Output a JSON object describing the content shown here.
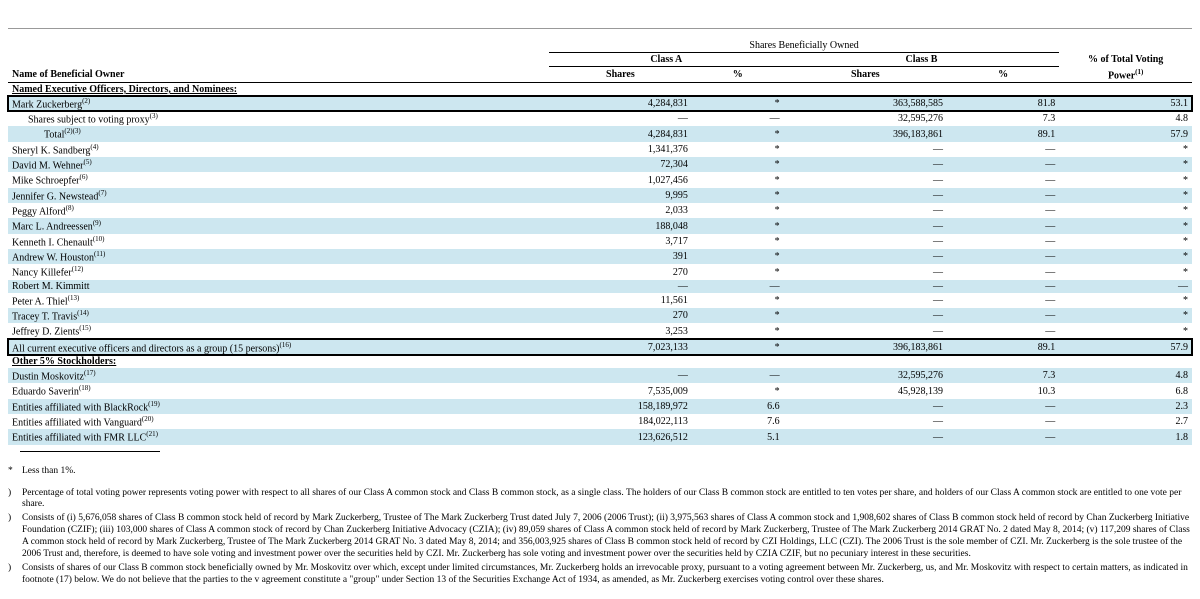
{
  "headers": {
    "main": "Shares Beneficially Owned",
    "name": "Name of Beneficial Owner",
    "classA": "Class A",
    "classB": "Class B",
    "shares": "Shares",
    "pct": "%",
    "voting": "% of Total Voting",
    "power": "Power",
    "power_sup": "(1)"
  },
  "sections": {
    "named": "Named Executive Officers, Directors, and Nominees:",
    "other": "Other 5% Stockholders:"
  },
  "rows": [
    {
      "k": "zuck",
      "alt": true,
      "hl": true,
      "name": "Mark Zuckerberg",
      "sup": "(2)",
      "a_sh": "4,284,831",
      "a_pc": "*",
      "b_sh": "363,588,585",
      "b_pc": "81.8",
      "vp": "53.1"
    },
    {
      "k": "proxy",
      "name": "Shares subject to voting proxy",
      "sup": "(3)",
      "a_sh": "—",
      "a_pc": "—",
      "b_sh": "32,595,276",
      "b_pc": "7.3",
      "vp": "4.8",
      "indent": 1
    },
    {
      "k": "total",
      "alt": true,
      "name": "Total",
      "sup": "(2)(3)",
      "a_sh": "4,284,831",
      "a_pc": "*",
      "b_sh": "396,183,861",
      "b_pc": "89.1",
      "vp": "57.9",
      "indent": 2
    },
    {
      "k": "sandberg",
      "name": "Sheryl K. Sandberg",
      "sup": "(4)",
      "a_sh": "1,341,376",
      "a_pc": "*",
      "b_sh": "—",
      "b_pc": "—",
      "vp": "*"
    },
    {
      "k": "wehner",
      "alt": true,
      "name": "David M. Wehner",
      "sup": "(5)",
      "a_sh": "72,304",
      "a_pc": "*",
      "b_sh": "—",
      "b_pc": "—",
      "vp": "*"
    },
    {
      "k": "schroepfer",
      "name": "Mike Schroepfer",
      "sup": "(6)",
      "a_sh": "1,027,456",
      "a_pc": "*",
      "b_sh": "—",
      "b_pc": "—",
      "vp": "*"
    },
    {
      "k": "newstead",
      "alt": true,
      "name": "Jennifer G. Newstead",
      "sup": "(7)",
      "a_sh": "9,995",
      "a_pc": "*",
      "b_sh": "—",
      "b_pc": "—",
      "vp": "*"
    },
    {
      "k": "alford",
      "name": "Peggy Alford",
      "sup": "(8)",
      "a_sh": "2,033",
      "a_pc": "*",
      "b_sh": "—",
      "b_pc": "—",
      "vp": "*"
    },
    {
      "k": "andreessen",
      "alt": true,
      "name": "Marc L. Andreessen",
      "sup": "(9)",
      "a_sh": "188,048",
      "a_pc": "*",
      "b_sh": "—",
      "b_pc": "—",
      "vp": "*"
    },
    {
      "k": "chenault",
      "name": "Kenneth I. Chenault",
      "sup": "(10)",
      "a_sh": "3,717",
      "a_pc": "*",
      "b_sh": "—",
      "b_pc": "—",
      "vp": "*"
    },
    {
      "k": "houston",
      "alt": true,
      "name": "Andrew W. Houston",
      "sup": "(11)",
      "a_sh": "391",
      "a_pc": "*",
      "b_sh": "—",
      "b_pc": "—",
      "vp": "*"
    },
    {
      "k": "killefer",
      "name": "Nancy Killefer",
      "sup": "(12)",
      "a_sh": "270",
      "a_pc": "*",
      "b_sh": "—",
      "b_pc": "—",
      "vp": "*"
    },
    {
      "k": "kimmitt",
      "alt": true,
      "name": "Robert M. Kimmitt",
      "a_sh": "—",
      "a_pc": "—",
      "b_sh": "—",
      "b_pc": "—",
      "vp": "—"
    },
    {
      "k": "thiel",
      "name": "Peter A. Thiel",
      "sup": "(13)",
      "a_sh": "11,561",
      "a_pc": "*",
      "b_sh": "—",
      "b_pc": "—",
      "vp": "*"
    },
    {
      "k": "travis",
      "alt": true,
      "name": "Tracey T. Travis",
      "sup": "(14)",
      "a_sh": "270",
      "a_pc": "*",
      "b_sh": "—",
      "b_pc": "—",
      "vp": "*"
    },
    {
      "k": "zients",
      "name": "Jeffrey D. Zients",
      "sup": "(15)",
      "a_sh": "3,253",
      "a_pc": "*",
      "b_sh": "—",
      "b_pc": "—",
      "vp": "*",
      "ul": true
    },
    {
      "k": "group",
      "alt": true,
      "hl": true,
      "name": "All current executive officers and directors as a group (15 persons)",
      "sup": "(16)",
      "a_sh": "7,023,133",
      "a_pc": "*",
      "b_sh": "396,183,861",
      "b_pc": "89.1",
      "vp": "57.9"
    }
  ],
  "other_rows": [
    {
      "k": "moskovitz",
      "alt": true,
      "name": "Dustin Moskovitz",
      "sup": "(17)",
      "a_sh": "—",
      "a_pc": "—",
      "b_sh": "32,595,276",
      "b_pc": "7.3",
      "vp": "4.8"
    },
    {
      "k": "saverin",
      "name": "Eduardo Saverin",
      "sup": "(18)",
      "a_sh": "7,535,009",
      "a_pc": "*",
      "b_sh": "45,928,139",
      "b_pc": "10.3",
      "vp": "6.8"
    },
    {
      "k": "blackrock",
      "alt": true,
      "name": "Entities affiliated with BlackRock",
      "sup": "(19)",
      "a_sh": "158,189,972",
      "a_pc": "6.6",
      "b_sh": "—",
      "b_pc": "—",
      "vp": "2.3"
    },
    {
      "k": "vanguard",
      "name": "Entities affiliated with Vanguard",
      "sup": "(20)",
      "a_sh": "184,022,113",
      "a_pc": "7.6",
      "b_sh": "—",
      "b_pc": "—",
      "vp": "2.7"
    },
    {
      "k": "fmr",
      "alt": true,
      "name": "Entities affiliated with FMR LLC",
      "sup": "(21)",
      "a_sh": "123,626,512",
      "a_pc": "5.1",
      "b_sh": "—",
      "b_pc": "—",
      "vp": "1.8"
    }
  ],
  "footnotes": {
    "star": "Less than 1%.",
    "f1": "Percentage of total voting power represents voting power with respect to all shares of our Class A common stock and Class B common stock, as a single class. The holders of our Class B common stock are entitled to ten votes per share, and holders of our Class A common stock are entitled to one vote per share.",
    "f2": "Consists of (i) 5,676,058 shares of Class B common stock held of record by Mark Zuckerberg, Trustee of The Mark Zuckerberg Trust dated July 7, 2006 (2006 Trust); (ii) 3,975,563 shares of Class A common stock and 1,908,602 shares of Class B common stock held of record by Chan Zuckerberg Initiative Foundation (CZIF); (iii) 103,000 shares of Class A common stock of record by Chan Zuckerberg Initiative Advocacy (CZIA); (iv) 89,059 shares of Class A common stock held of record by Mark Zuckerberg, Trustee of The Mark Zuckerberg 2014 GRAT No. 2 dated May 8, 2014; (v) 117,209 shares of Class A common stock held of record by Mark Zuckerberg, Trustee of The Mark Zuckerberg 2014 GRAT No. 3 dated May 8, 2014; and 356,003,925 shares of Class B common stock held of record by CZI Holdings, LLC (CZI). The 2006 Trust is the sole member of CZI. Mr. Zuckerberg is the sole trustee of the 2006 Trust and, therefore, is deemed to have sole voting and investment power over the securities held by CZI. Mr. Zuckerberg has sole voting and investment power over the securities held by CZIA CZIF, but no pecuniary interest in these securities.",
    "f3": "Consists of shares of our Class B common stock beneficially owned by Mr. Moskovitz over which, except under limited circumstances, Mr. Zuckerberg holds an irrevocable proxy, pursuant to a voting agreement between Mr. Zuckerberg, us, and Mr. Moskovitz with respect to certain matters, as indicated in footnote (17) below. We do not believe that the parties to the v agreement constitute a \"group\" under Section 13 of the Securities Exchange Act of 1934, as amended, as Mr. Zuckerberg exercises voting control over these shares."
  }
}
